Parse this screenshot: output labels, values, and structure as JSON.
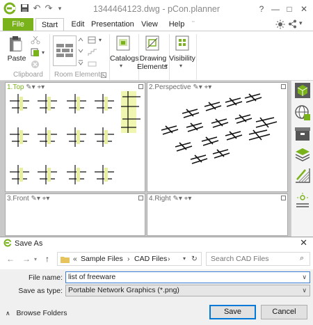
{
  "window": {
    "title": "1344464123.dwg - pCon.planner",
    "help_label": "?",
    "minimize_label": "—",
    "maximize_label": "□",
    "close_label": "✕"
  },
  "ribbon": {
    "file_tab": "File",
    "tabs": [
      "Start",
      "Edit",
      "Presentation",
      "View",
      "Help"
    ],
    "active_tab": "Start",
    "more_tabs": "¨",
    "paste_label": "Paste",
    "clipboard_group": "Clipboard",
    "room_elements_group": "Room Elements",
    "catalogs_label": "Catalogs",
    "drawing_elements_label_1": "Drawing",
    "drawing_elements_label_2": "Elements",
    "visibility_label": "Visibility",
    "accent_color": "#7ab21b"
  },
  "viewports": {
    "top": "1.Top",
    "perspective": "2.Perspective",
    "front": "3.Front",
    "right": "4.Right"
  },
  "dialog": {
    "title": "Save As",
    "close_label": "✕",
    "breadcrumb": [
      "Sample Files",
      "CAD Files"
    ],
    "breadcrumb_prefix": "«",
    "search_placeholder": "Search CAD Files",
    "file_name_label": "File name:",
    "file_name_value": "list of freeware",
    "save_as_type_label": "Save as type:",
    "save_as_type_value": "Portable Network Graphics (*.png)",
    "browse_folders_label": "Browse Folders",
    "save_button": "Save",
    "cancel_button": "Cancel"
  }
}
